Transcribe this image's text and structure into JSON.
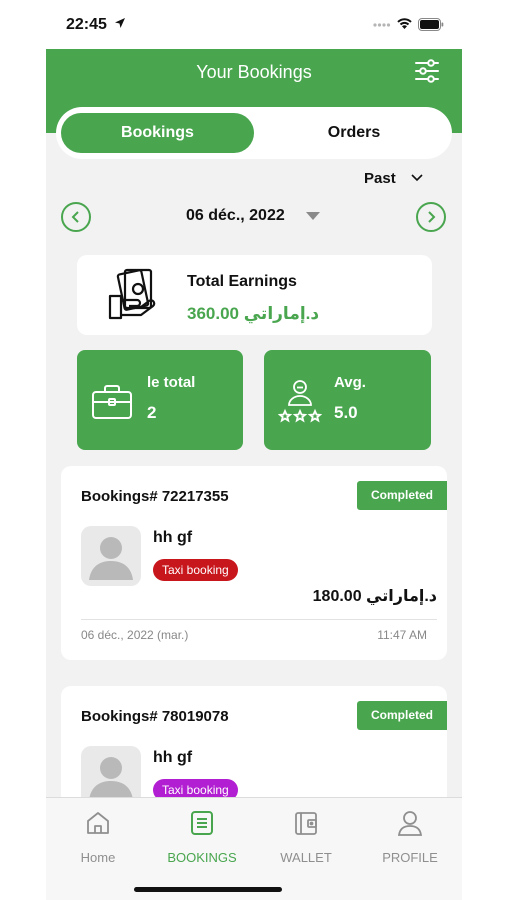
{
  "status_bar": {
    "time": "22:45"
  },
  "header": {
    "title": "Your Bookings"
  },
  "segments": {
    "active": "Bookings",
    "other": "Orders"
  },
  "filter": {
    "period": "Past"
  },
  "date_nav": {
    "date": "06 déc., 2022"
  },
  "earnings": {
    "title": "Total Earnings",
    "value": "360.00 د.إماراتي"
  },
  "stats": [
    {
      "label": "le total",
      "value": "2"
    },
    {
      "label": "Avg.",
      "value": "5.0"
    }
  ],
  "bookings": [
    {
      "id": "Bookings# 72217355",
      "status": "Completed",
      "name": "hh gf",
      "tag": "Taxi booking",
      "tag_color": "#c8161d",
      "amount": "180.00 د.إماراتي",
      "date": "06 déc., 2022 (mar.)",
      "time": "11:47 AM"
    },
    {
      "id": "Bookings# 78019078",
      "status": "Completed",
      "name": "hh gf",
      "tag": "Taxi booking",
      "tag_color": "#b21ed1"
    }
  ],
  "tabs": [
    {
      "label": "Home",
      "icon": "home-icon"
    },
    {
      "label": "BOOKINGS",
      "icon": "bookings-icon"
    },
    {
      "label": "WALLET",
      "icon": "wallet-icon"
    },
    {
      "label": "PROFILE",
      "icon": "profile-icon"
    }
  ],
  "colors": {
    "primary": "#49a64f",
    "background": "#f2f2f2"
  }
}
